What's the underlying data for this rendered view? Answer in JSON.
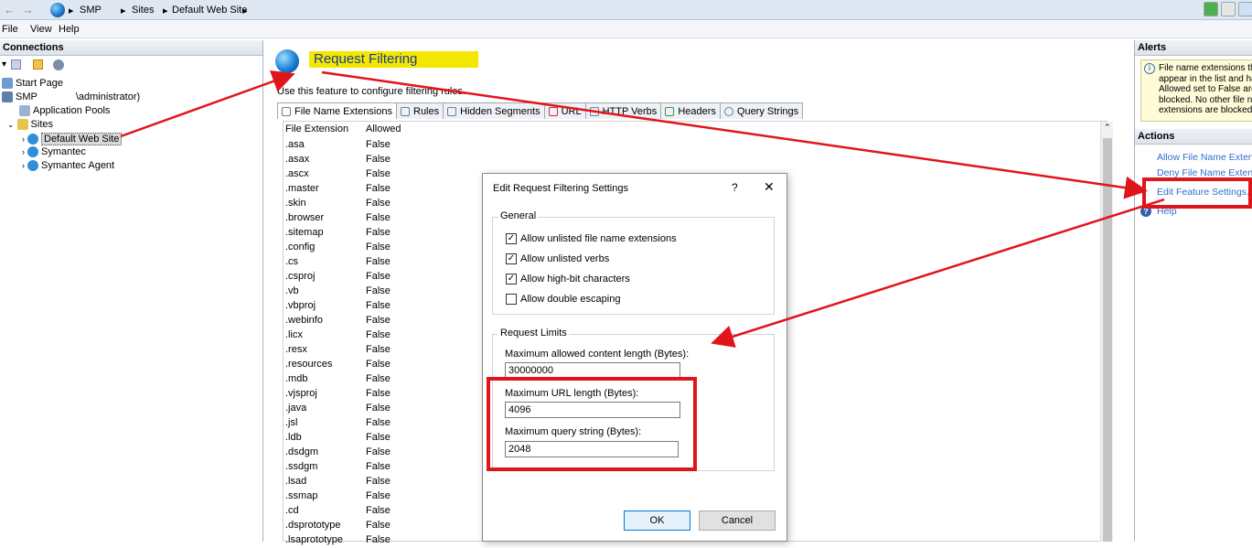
{
  "address_bar": {
    "back_glyph": "←",
    "forward_glyph": "→",
    "crumbs": [
      "SMP",
      "Sites",
      "Default Web Site"
    ]
  },
  "menu": [
    "File",
    "View",
    "Help"
  ],
  "connections": {
    "header": "Connections",
    "tree": [
      {
        "label": "Start Page",
        "level": 0
      },
      {
        "label": "SMP",
        "suffix": "\\administrator)",
        "level": 0
      },
      {
        "label": "Application Pools",
        "level": 1
      },
      {
        "label": "Sites",
        "level": 1
      },
      {
        "label": "Default Web Site",
        "level": 2,
        "selected": true
      },
      {
        "label": "Symantec",
        "level": 2
      },
      {
        "label": "Symantec Agent",
        "level": 2
      }
    ]
  },
  "main": {
    "title": "Request Filtering",
    "description": "Use this feature to configure filtering rules.",
    "tabs": [
      "File Name Extensions",
      "Rules",
      "Hidden Segments",
      "URL",
      "HTTP Verbs",
      "Headers",
      "Query Strings"
    ],
    "columns": [
      "File Extension",
      "Allowed"
    ],
    "rows": [
      [
        ".asa",
        "False"
      ],
      [
        ".asax",
        "False"
      ],
      [
        ".ascx",
        "False"
      ],
      [
        ".master",
        "False"
      ],
      [
        ".skin",
        "False"
      ],
      [
        ".browser",
        "False"
      ],
      [
        ".sitemap",
        "False"
      ],
      [
        ".config",
        "False"
      ],
      [
        ".cs",
        "False"
      ],
      [
        ".csproj",
        "False"
      ],
      [
        ".vb",
        "False"
      ],
      [
        ".vbproj",
        "False"
      ],
      [
        ".webinfo",
        "False"
      ],
      [
        ".licx",
        "False"
      ],
      [
        ".resx",
        "False"
      ],
      [
        ".resources",
        "False"
      ],
      [
        ".mdb",
        "False"
      ],
      [
        ".vjsproj",
        "False"
      ],
      [
        ".java",
        "False"
      ],
      [
        ".jsl",
        "False"
      ],
      [
        ".ldb",
        "False"
      ],
      [
        ".dsdgm",
        "False"
      ],
      [
        ".ssdgm",
        "False"
      ],
      [
        ".lsad",
        "False"
      ],
      [
        ".ssmap",
        "False"
      ],
      [
        ".cd",
        "False"
      ],
      [
        ".dsprototype",
        "False"
      ],
      [
        ".lsaprototype",
        "False"
      ]
    ]
  },
  "alerts": {
    "header": "Alerts",
    "lines": [
      "File name extensions th",
      "appear in the list and ha",
      "Allowed set to False are",
      "blocked. No other file n",
      "extensions are blocked."
    ]
  },
  "actions": {
    "header": "Actions",
    "items": [
      "Allow File Name Extensi",
      "Deny File Name Extensi",
      "Edit Feature Settings...",
      "Help"
    ]
  },
  "dialog": {
    "title": "Edit Request Filtering Settings",
    "help_glyph": "?",
    "close_glyph": "✕",
    "general_label": "General",
    "checkboxes": [
      {
        "label": "Allow unlisted file name extensions",
        "checked": true
      },
      {
        "label": "Allow unlisted verbs",
        "checked": true
      },
      {
        "label": "Allow high-bit characters",
        "checked": true
      },
      {
        "label": "Allow double escaping",
        "checked": false
      }
    ],
    "limits_label": "Request Limits",
    "content_length_label": "Maximum allowed content length (Bytes):",
    "content_length_value": "30000000",
    "url_length_label": "Maximum URL length (Bytes):",
    "url_length_value": "4096",
    "query_string_label": "Maximum query string (Bytes):",
    "query_string_value": "2048",
    "ok_label": "OK",
    "cancel_label": "Cancel"
  },
  "colors": {
    "annotation_red": "#e0151b",
    "highlight_yellow": "#f5e800",
    "link_blue": "#2e6fd0"
  }
}
